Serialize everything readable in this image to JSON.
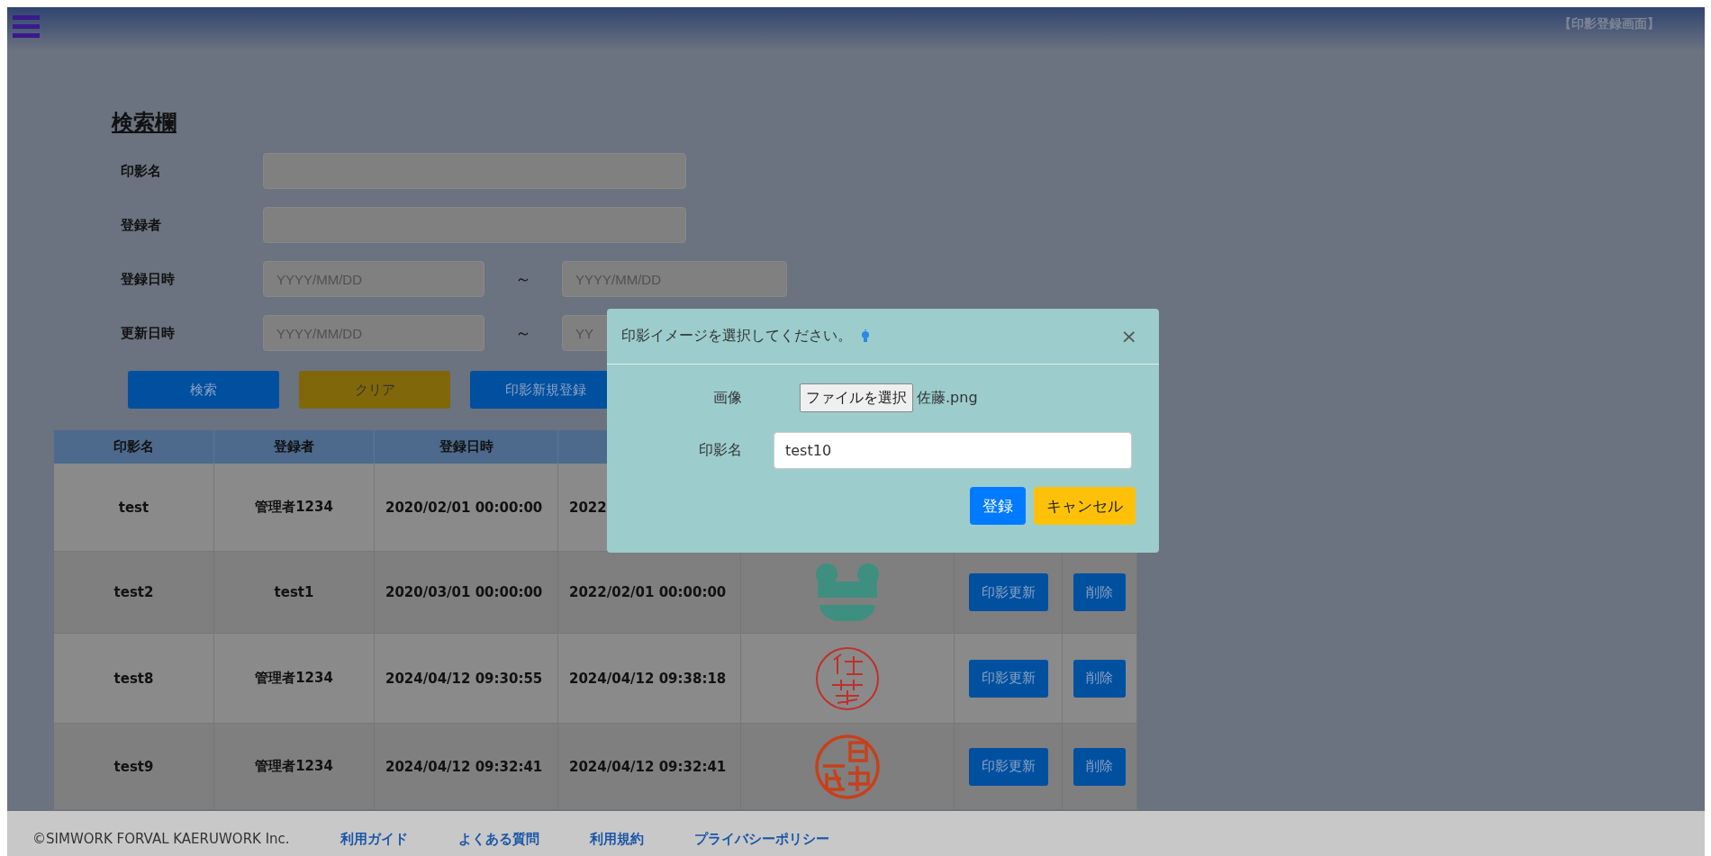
{
  "header": {
    "title": "【印影登録画面】"
  },
  "search": {
    "heading": "検索欄",
    "fields": [
      {
        "kind": "text",
        "label": "印影名"
      },
      {
        "kind": "text",
        "label": "登録者"
      },
      {
        "kind": "range",
        "label": "登録日時",
        "from_placeholder": "YYYY/MM/DD",
        "separator": "～",
        "to_placeholder": "YYYY/MM/DD"
      },
      {
        "kind": "range",
        "label": "更新日時",
        "from_placeholder": "YYYY/MM/DD",
        "separator": "～",
        "to_placeholder": "YY"
      }
    ],
    "buttons": [
      {
        "label": "検索",
        "kind": "primary"
      },
      {
        "label": "クリア",
        "kind": "warning"
      },
      {
        "label": "印影新規登録",
        "kind": "primary"
      }
    ]
  },
  "table": {
    "columns": [
      "印影名",
      "登録者",
      "登録日時"
    ],
    "rows": [
      {
        "name": "test",
        "registrant": "管理者1234",
        "registered": "2020/02/01 00:00:00",
        "column_4": "2022",
        "actions": []
      },
      {
        "name": "test2",
        "registrant": "test1",
        "registered": "2020/03/01 00:00:00",
        "column_4": "2022/02/01 00:00:00",
        "stamp": {
          "kind": "frog"
        },
        "actions": [
          "印影更新",
          "削除"
        ]
      },
      {
        "name": "test8",
        "registrant": "管理者1234",
        "registered": "2024/04/12 09:30:55",
        "column_4": "2024/04/12 09:38:18",
        "stamp": {
          "kind": "seal-thin"
        },
        "actions": [
          "印影更新",
          "削除"
        ]
      },
      {
        "name": "test9",
        "registrant": "管理者1234",
        "registered": "2024/04/12 09:32:41",
        "column_4": "2024/04/12 09:32:41",
        "stamp": {
          "kind": "seal-bold"
        },
        "actions": [
          "印影更新",
          "削除"
        ]
      }
    ]
  },
  "footer": {
    "copyright": "©SIMWORK FORVAL KAERUWORK Inc.",
    "links": [
      "利用ガイド",
      "よくある質問",
      "利用規約",
      "プライバシーポリシー"
    ]
  },
  "modal": {
    "title": "印影イメージを選択してください。",
    "close": "×",
    "image_label": "画像",
    "file_button": "ファイルを選択",
    "file_name": "佐藤.png",
    "name_label": "印影名",
    "name_value": "test10",
    "buttons": [
      {
        "label": "登録",
        "kind": "primary"
      },
      {
        "label": "キャンセル",
        "kind": "warning"
      }
    ]
  }
}
